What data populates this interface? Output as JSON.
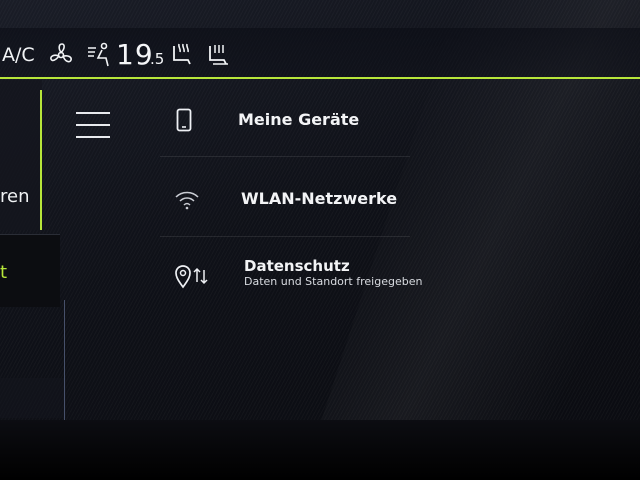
{
  "status_bar": {
    "ac_label": "A/C",
    "temperature_int": "19",
    "temperature_dec": ".5",
    "accent_color": "#b7e63a"
  },
  "left_nav": {
    "partial_label": "ren",
    "active_partial": "t"
  },
  "menu": {
    "icon": "hamburger-menu-icon"
  },
  "items": [
    {
      "label": "Meine Geräte",
      "icon": "smartphone-icon"
    },
    {
      "label": "WLAN-Netzwerke",
      "icon": "wifi-icon"
    },
    {
      "label": "Datenschutz",
      "sublabel": "Daten und Standort freigegeben",
      "icon": "location-data-icon"
    }
  ]
}
